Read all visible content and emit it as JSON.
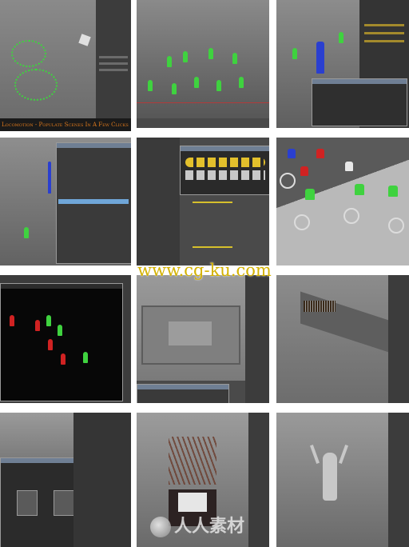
{
  "tiles": [
    {
      "id": "t1",
      "caption": "Locomotion - Populate Scenes In A Few Clicks"
    },
    {
      "id": "t2"
    },
    {
      "id": "t3"
    },
    {
      "id": "t4"
    },
    {
      "id": "t5"
    },
    {
      "id": "t6"
    },
    {
      "id": "t7"
    },
    {
      "id": "t8"
    },
    {
      "id": "t9"
    },
    {
      "id": "t10"
    },
    {
      "id": "t11"
    },
    {
      "id": "t12"
    }
  ],
  "watermark": {
    "url": "www.cg-ku.com",
    "brand": "人人素材"
  },
  "colors": {
    "crowd_green": "#3fd23f",
    "crowd_red": "#d02222",
    "crowd_blue": "#2a3fd0",
    "caption_text": "#e07a1c",
    "watermark_url": "#d4b200",
    "ui_dark": "#3c3c3c"
  }
}
